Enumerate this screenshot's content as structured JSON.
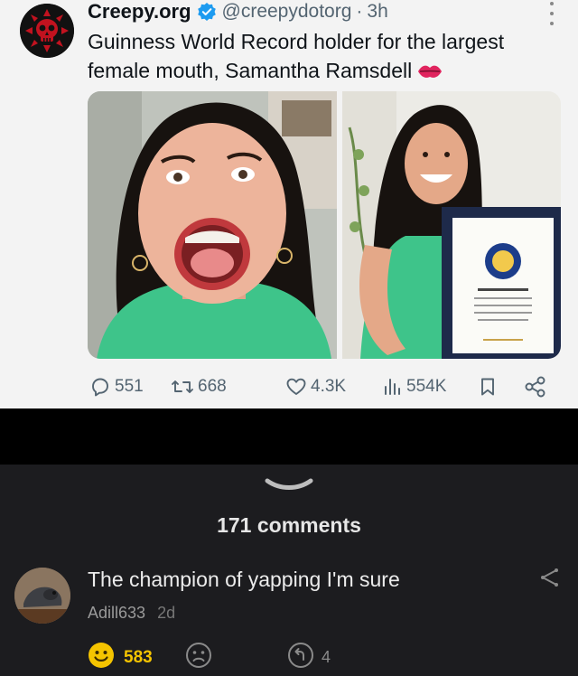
{
  "tweet": {
    "display_name": "Creepy.org",
    "handle": "@creepydotorg",
    "separator": "·",
    "time": "3h",
    "text": "Guinness World Record holder for the largest female mouth, Samantha Ramsdell",
    "actions": {
      "replies": "551",
      "retweets": "668",
      "likes": "4.3K",
      "views": "554K"
    },
    "colors": {
      "verified": "#1d9bf0",
      "avatar_red": "#c1121f"
    }
  },
  "comments": {
    "count_label": "171 comments",
    "items": [
      {
        "text": "The champion of yapping I'm sure",
        "user": "Adill633",
        "age": "2d",
        "likes": "583",
        "replies": "4"
      }
    ],
    "colors": {
      "accent": "#f5c400"
    }
  }
}
